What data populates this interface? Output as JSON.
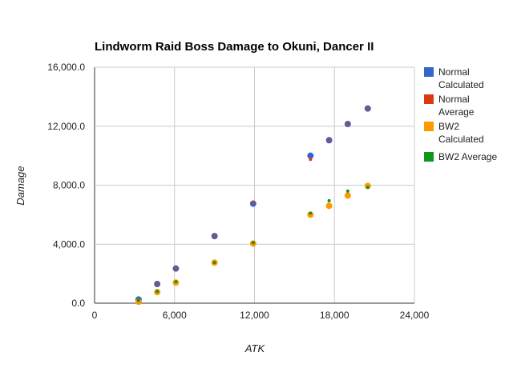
{
  "chart_data": {
    "type": "scatter",
    "title": "Lindworm Raid Boss Damage to Okuni, Dancer II",
    "xlabel": "ATK",
    "ylabel": "Damage",
    "xlim": [
      0,
      24000
    ],
    "ylim": [
      0,
      16000
    ],
    "x_ticks": [
      0,
      6000,
      12000,
      18000,
      24000
    ],
    "x_tick_labels": [
      "0",
      "6,000",
      "12,000",
      "18,000",
      "24,000"
    ],
    "y_ticks": [
      0,
      4000,
      8000,
      12000,
      16000
    ],
    "y_tick_labels": [
      "0.0",
      "4,000.0",
      "8,000.0",
      "12,000.0",
      "16,000.0"
    ],
    "grid": true,
    "legend_position": "right",
    "series": [
      {
        "name": "Normal Calculated",
        "legend_lines": [
          "Normal",
          "Calculated"
        ],
        "color": "#3366cc",
        "size": "large",
        "x": [
          3300,
          4700,
          6100,
          9000,
          11900,
          16200,
          17600,
          19000,
          20500
        ],
        "y": [
          250,
          1300,
          2350,
          4550,
          6750,
          10000,
          11050,
          12150,
          13200
        ]
      },
      {
        "name": "Normal Average",
        "legend_lines": [
          "Normal",
          "Average"
        ],
        "color": "#dc3912",
        "size": "small",
        "x": [
          3300,
          4700,
          6100,
          9000,
          11900,
          16200,
          17600,
          19000,
          20500
        ],
        "y": [
          250,
          1300,
          2350,
          4550,
          6850,
          9750,
          11050,
          12150,
          13200
        ]
      },
      {
        "name": "BW2 Calculated",
        "legend_lines": [
          "BW2",
          "Calculated"
        ],
        "color": "#ff9900",
        "size": "large",
        "x": [
          3300,
          4700,
          6100,
          9000,
          11900,
          16200,
          17600,
          19000,
          20500
        ],
        "y": [
          100,
          750,
          1400,
          2750,
          4050,
          6000,
          6600,
          7300,
          7950
        ]
      },
      {
        "name": "BW2 Average",
        "legend_lines": [
          "BW2 Average"
        ],
        "color": "#109618",
        "size": "small",
        "x": [
          3300,
          4700,
          6100,
          9000,
          11900,
          16200,
          17600,
          19000,
          20500
        ],
        "y": [
          200,
          800,
          1450,
          2750,
          4100,
          6100,
          6950,
          7600,
          7850
        ]
      }
    ]
  }
}
